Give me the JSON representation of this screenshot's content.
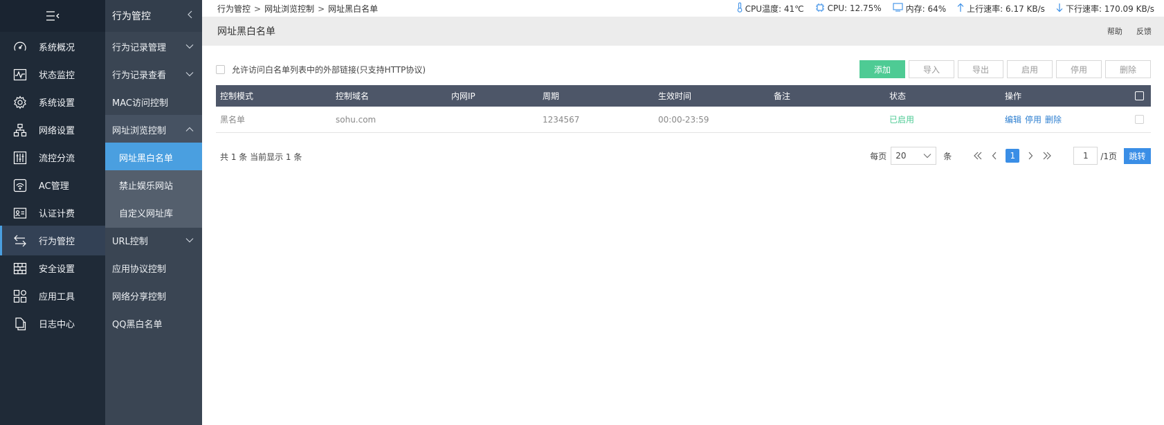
{
  "colors": {
    "sidebar_bg": "#1f2a37",
    "subnav_bg": "#3a4553",
    "active_blue": "#4a9fe0",
    "add_green": "#4ecb94",
    "table_header": "#4d5668",
    "link_blue": "#2e7fd0"
  },
  "sidebar": {
    "toggle_icon": "menu-collapse-icon",
    "items": [
      {
        "label": "系统概况",
        "icon": "dashboard-gauge-icon"
      },
      {
        "label": "状态监控",
        "icon": "pulse-monitor-icon"
      },
      {
        "label": "系统设置",
        "icon": "gear-icon"
      },
      {
        "label": "网络设置",
        "icon": "network-topology-icon"
      },
      {
        "label": "流控分流",
        "icon": "sliders-icon"
      },
      {
        "label": "AC管理",
        "icon": "wifi-router-icon"
      },
      {
        "label": "认证计费",
        "icon": "id-card-icon"
      },
      {
        "label": "行为管控",
        "icon": "swap-arrows-icon"
      },
      {
        "label": "安全设置",
        "icon": "firewall-icon"
      },
      {
        "label": "应用工具",
        "icon": "apps-grid-icon"
      },
      {
        "label": "日志中心",
        "icon": "document-copy-icon"
      }
    ],
    "active_index": 7
  },
  "subnav": {
    "title": "行为管控",
    "items": [
      {
        "label": "行为记录管理",
        "has_children": true
      },
      {
        "label": "行为记录查看",
        "has_children": true
      },
      {
        "label": "MAC访问控制",
        "has_children": false
      },
      {
        "label": "网址浏览控制",
        "has_children": true,
        "expanded": true
      },
      {
        "label": "URL控制",
        "has_children": true
      },
      {
        "label": "应用协议控制",
        "has_children": false
      },
      {
        "label": "网络分享控制",
        "has_children": false
      },
      {
        "label": "QQ黑白名单",
        "has_children": false
      }
    ],
    "children": [
      {
        "label": "网址黑白名单",
        "active": true
      },
      {
        "label": "禁止娱乐网站",
        "active": false
      },
      {
        "label": "自定义网址库",
        "active": false
      }
    ]
  },
  "breadcrumb": [
    "行为管控",
    "网址浏览控制",
    "网址黑白名单"
  ],
  "stats": {
    "cpu_temp": "CPU温度: 41℃",
    "cpu": "CPU: 12.75%",
    "mem": "内存: 64%",
    "up": "上行速率: 6.17 KB/s",
    "down": "下行速率: 170.09 KB/s"
  },
  "page": {
    "title": "网址黑白名单",
    "help": "帮助",
    "feedback": "反馈"
  },
  "option": {
    "allow_external_links": "允许访问白名单列表中的外部链接(只支持HTTP协议)"
  },
  "toolbar": {
    "add": "添加",
    "import": "导入",
    "export": "导出",
    "enable": "启用",
    "disable": "停用",
    "delete": "删除"
  },
  "table": {
    "headers": [
      "控制模式",
      "控制域名",
      "内网IP",
      "周期",
      "生效时间",
      "备注",
      "状态",
      "操作"
    ],
    "rows": [
      {
        "mode": "黑名单",
        "domain": "sohu.com",
        "ip": "",
        "period": "1234567",
        "time": "00:00-23:59",
        "note": "",
        "status": "已启用",
        "ops": [
          "编辑",
          "停用",
          "删除"
        ]
      }
    ]
  },
  "footer": {
    "summary": "共 1 条 当前显示 1 条",
    "per_page_label": "每页",
    "per_page_value": "20",
    "per_page_unit": "条",
    "current_page": "1",
    "jump_value": "1",
    "total_pages": "/1页",
    "jump_btn": "跳转"
  }
}
